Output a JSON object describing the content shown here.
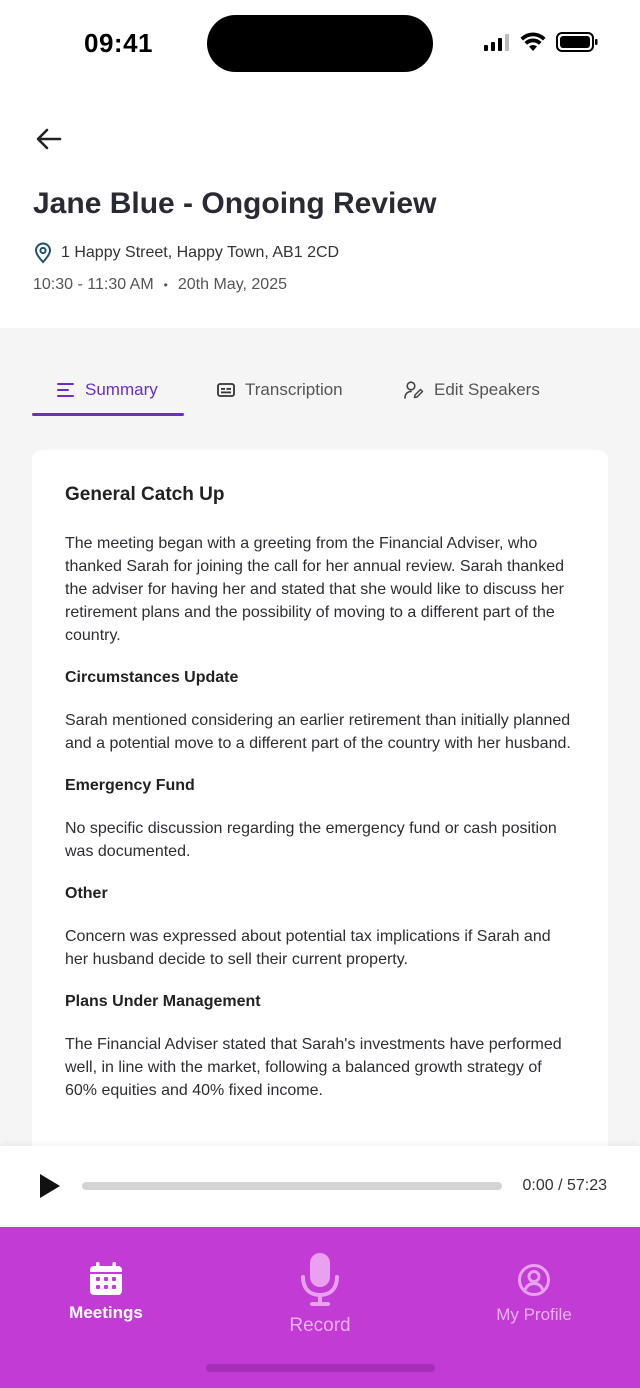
{
  "status": {
    "time": "09:41"
  },
  "meeting": {
    "title": "Jane Blue - Ongoing Review",
    "address": "1 Happy Street, Happy Town, AB1 2CD",
    "time_range": "10:30 - 11:30 AM",
    "separator": "•",
    "date": "20th May, 2025"
  },
  "tabs": [
    {
      "label": "Summary",
      "active": true
    },
    {
      "label": "Transcription",
      "active": false
    },
    {
      "label": "Edit Speakers",
      "active": false
    }
  ],
  "summary": {
    "heading": "General Catch Up",
    "intro": "The meeting began with a greeting from the Financial Adviser, who thanked Sarah for joining the call for her annual review. Sarah thanked the adviser for having her and stated that she would like to discuss her retirement plans and the possibility of moving to a different part of the country.",
    "sections": [
      {
        "title": "Circumstances Update",
        "body": "Sarah mentioned considering an earlier retirement than initially planned and a potential move to a different part of the country with her husband."
      },
      {
        "title": "Emergency Fund",
        "body": "No specific discussion regarding the emergency fund or cash position was documented."
      },
      {
        "title": "Other",
        "body": "Concern was expressed about potential tax implications if Sarah and her husband decide to sell their current property."
      },
      {
        "title": "Plans Under Management",
        "body": "The Financial Adviser stated that Sarah's investments have performed well, in line with the market, following a balanced growth strategy of 60% equities and 40% fixed income."
      }
    ]
  },
  "player": {
    "time": "0:00 / 57:23",
    "progress": 0
  },
  "nav": {
    "meetings": "Meetings",
    "record": "Record",
    "profile": "My Profile"
  },
  "colors": {
    "accent": "#6b2fc4",
    "nav_bg": "#c23bd4"
  }
}
